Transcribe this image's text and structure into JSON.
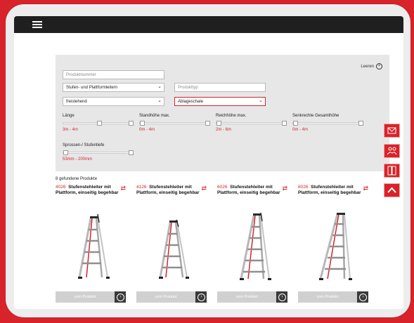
{
  "filter": {
    "reset_label": "Leeren",
    "product_number_placeholder": "Produktnummer",
    "category_value": "Stufen- und Plattformleitern",
    "product_type_placeholder": "Produkttyp",
    "mount_value": "freistehend",
    "accessory_value": "Ablageschale",
    "sliders": [
      {
        "label": "Länge",
        "range": "3m - 4m"
      },
      {
        "label": "Standhöhe max.",
        "range": "0m - 4m"
      },
      {
        "label": "Reichhöhe max.",
        "range": "2m - 6m"
      },
      {
        "label": "Senkrechte Gesamthöhe",
        "range": "0m - 4m"
      },
      {
        "label": "Sprossen-/ Stufentiefe",
        "range": "53mm - 200mm"
      }
    ]
  },
  "results_count": "8 gefundene Produkte",
  "products": [
    {
      "number": "4026",
      "name": "Stufenstehleiter mit Plattform, einseitig begehbar",
      "button": "zum Produkt"
    },
    {
      "number": "4126",
      "name": "Stufenstehleiter mit Plattform, einseitig begehbar",
      "button": "zum Produkt"
    },
    {
      "number": "6026",
      "name": "Stufenstehleiter mit Plattform, einseitig begehbar",
      "button": "zum Produkt"
    },
    {
      "number": "8026",
      "name": "Stufenstehleiter mit Plattform, einseitig begehbar",
      "button": "zum Produkt"
    }
  ],
  "side_buttons": [
    "contact-icon",
    "handshake-icon",
    "catalog-icon",
    "scroll-top-icon"
  ],
  "colors": {
    "brand": "#d8232a",
    "topbar": "#1f1f1f",
    "panel": "#e7e7e8"
  }
}
